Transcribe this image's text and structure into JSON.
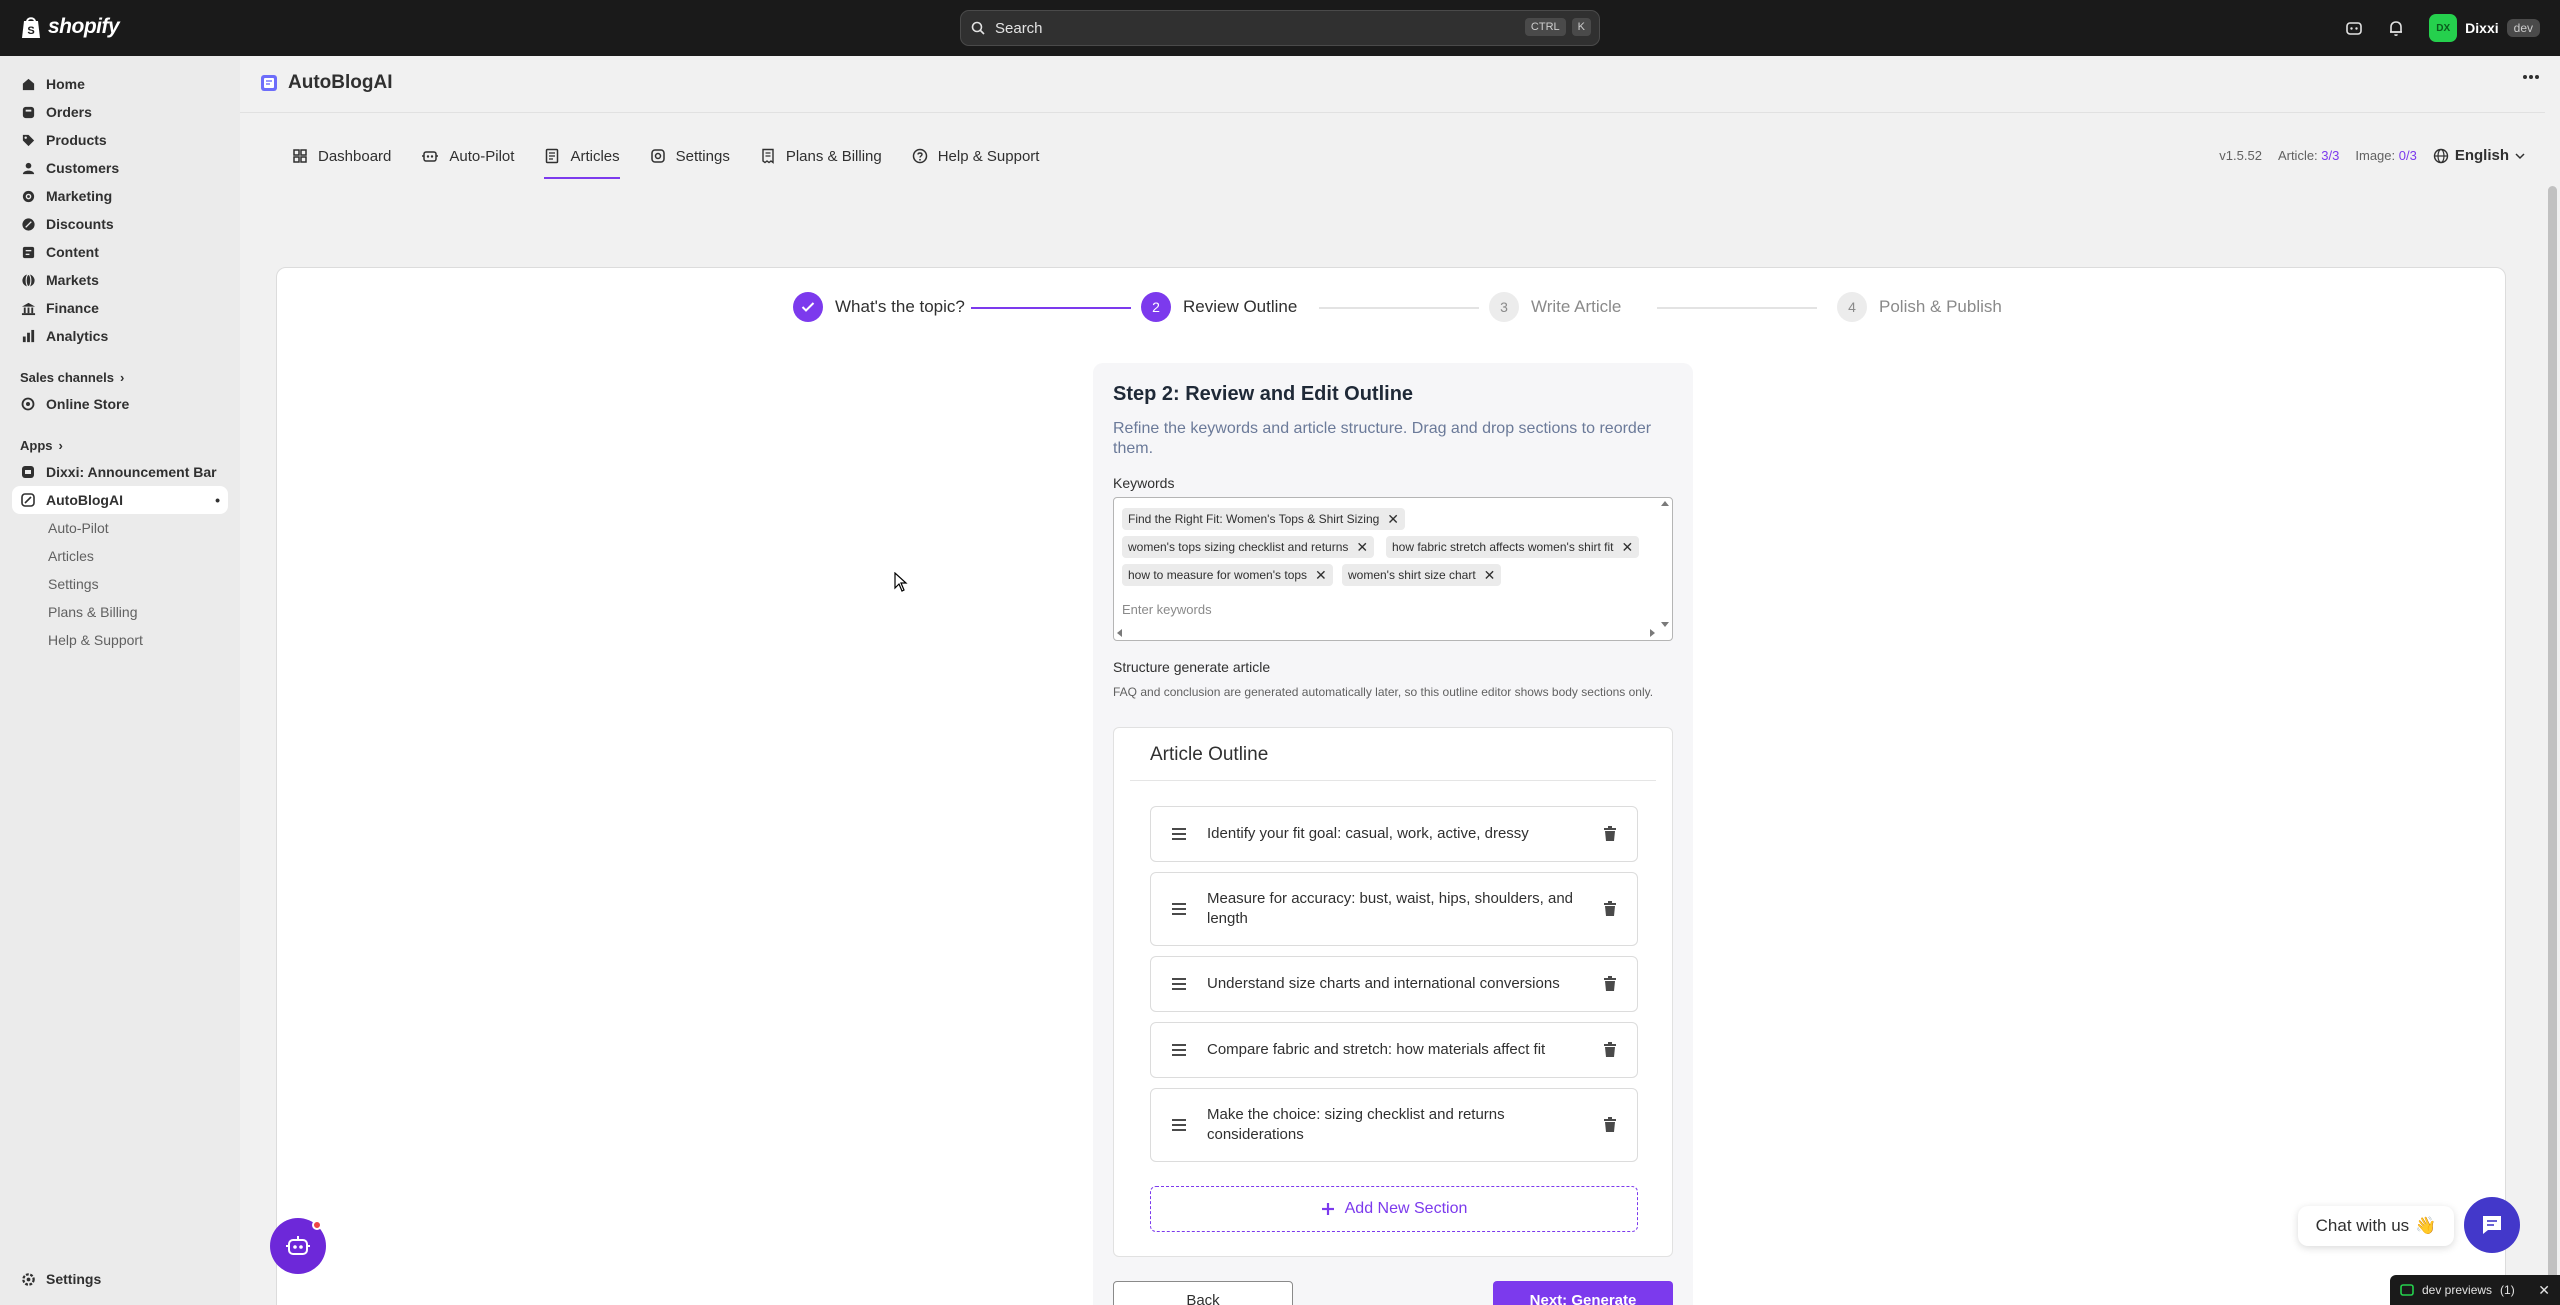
{
  "topbar": {
    "logo_text": "shopify",
    "search_placeholder": "Search",
    "kbd1": "CTRL",
    "kbd2": "K",
    "user_initials": "DX",
    "user_name": "Dixxi",
    "user_badge": "dev"
  },
  "sidebar": {
    "items": [
      {
        "label": "Home",
        "icon": "home-icon"
      },
      {
        "label": "Orders",
        "icon": "orders-icon"
      },
      {
        "label": "Products",
        "icon": "tag-icon"
      },
      {
        "label": "Customers",
        "icon": "person-icon"
      },
      {
        "label": "Marketing",
        "icon": "target-icon"
      },
      {
        "label": "Discounts",
        "icon": "discount-icon"
      },
      {
        "label": "Content",
        "icon": "content-icon"
      },
      {
        "label": "Markets",
        "icon": "globe-icon"
      },
      {
        "label": "Finance",
        "icon": "bank-icon"
      },
      {
        "label": "Analytics",
        "icon": "chart-icon"
      }
    ],
    "sales_channels_label": "Sales channels",
    "online_store": "Online Store",
    "apps_label": "Apps",
    "app1": "Dixxi: Announcement Bar",
    "app2": "AutoBlogAI",
    "app2_subs": [
      "Auto-Pilot",
      "Articles",
      "Settings",
      "Plans & Billing",
      "Help & Support"
    ],
    "settings": "Settings"
  },
  "app": {
    "title": "AutoBlogAI",
    "tabs": [
      {
        "label": "Dashboard"
      },
      {
        "label": "Auto-Pilot"
      },
      {
        "label": "Articles"
      },
      {
        "label": "Settings"
      },
      {
        "label": "Plans & Billing"
      },
      {
        "label": "Help & Support"
      }
    ],
    "version": "v1.5.52",
    "article_label": "Article:",
    "article_count": "3/3",
    "image_label": "Image:",
    "image_count": "0/3",
    "language": "English"
  },
  "stepper": {
    "steps": [
      {
        "num": "",
        "label": "What's the topic?"
      },
      {
        "num": "2",
        "label": "Review Outline"
      },
      {
        "num": "3",
        "label": "Write Article"
      },
      {
        "num": "4",
        "label": "Polish & Publish"
      }
    ]
  },
  "form": {
    "title": "Step 2: Review and Edit Outline",
    "subtitle": "Refine the keywords and article structure. Drag and drop sections to reorder them.",
    "keywords_label": "Keywords",
    "keywords": [
      "Find the Right Fit: Women's Tops & Shirt Sizing",
      "women's tops sizing checklist and returns",
      "how fabric stretch affects women's shirt fit",
      "how to measure for women's tops",
      "women's shirt size chart"
    ],
    "keywords_placeholder": "Enter keywords",
    "structure_label": "Structure generate article",
    "structure_note": "FAQ and conclusion are generated automatically later, so this outline editor shows body sections only.",
    "outline_title": "Article Outline",
    "sections": [
      "Identify your fit goal: casual, work, active, dressy",
      "Measure for accuracy: bust, waist, hips, shoulders, and length",
      "Understand size charts and international conversions",
      "Compare fabric and stretch: how materials affect fit",
      "Make the choice: sizing checklist and returns considerations"
    ],
    "add_section": "Add New Section",
    "back": "Back",
    "next": "Next: Generate"
  },
  "floating": {
    "chat_label": "Chat with us",
    "chat_emoji": "👋",
    "dev_previews": "dev previews",
    "dev_previews_count": "(1)"
  },
  "colors": {
    "accent": "#7c3aed",
    "topbar": "#1a1a1a",
    "sidebar": "#ebebeb"
  }
}
